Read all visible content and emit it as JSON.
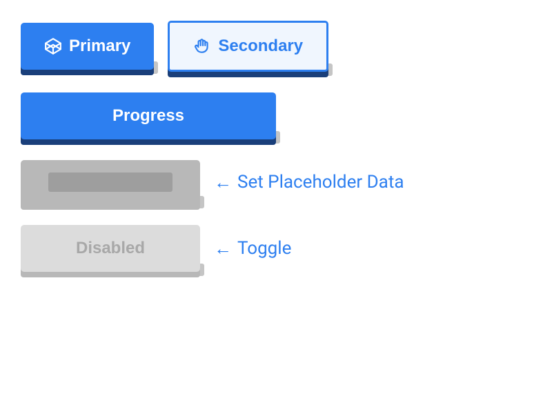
{
  "buttons": {
    "primary": {
      "label": "Primary"
    },
    "secondary": {
      "label": "Secondary"
    },
    "progress": {
      "label": "Progress"
    },
    "disabled": {
      "label": "Disabled"
    }
  },
  "labels": {
    "set_placeholder": "Set Placeholder Data",
    "toggle": "Toggle"
  },
  "colors": {
    "primary": "#2d7ff0",
    "primary_dark": "#1a3f7a",
    "secondary_bg": "#f0f6fe",
    "disabled_bg": "#dcdcdc",
    "disabled_text": "#a8a8a8",
    "placeholder_bg": "#b8b8b8",
    "placeholder_bar": "#9e9e9e",
    "shadow": "#c5c5c5"
  }
}
